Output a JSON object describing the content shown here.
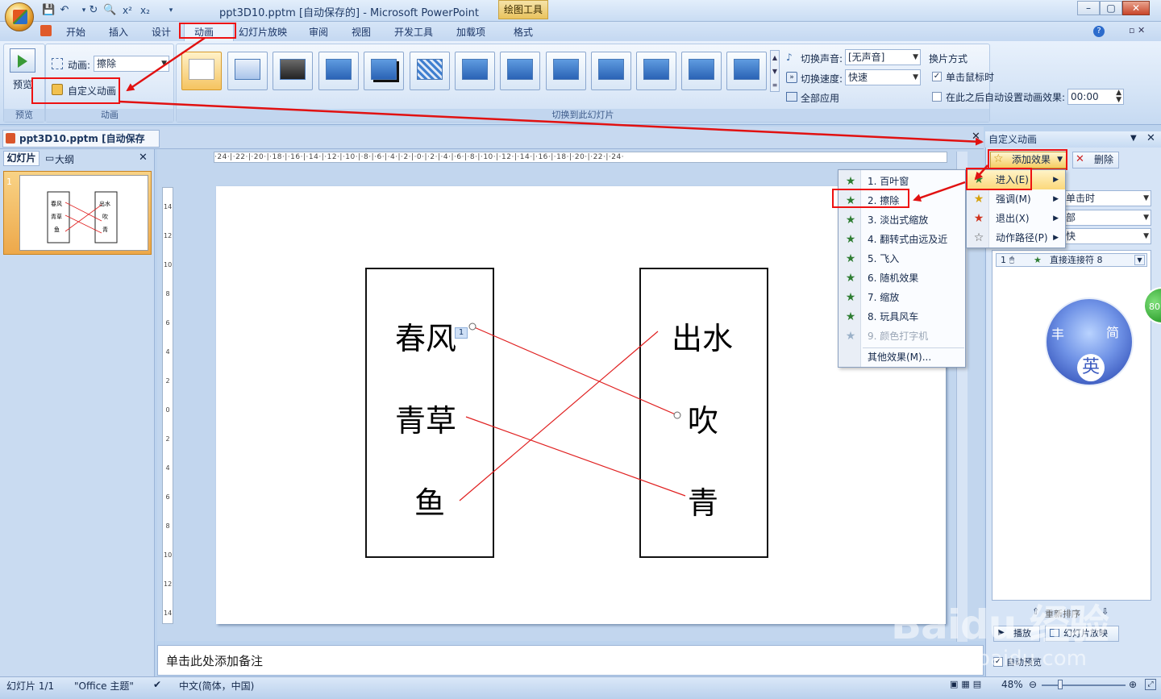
{
  "window": {
    "title": "ppt3D10.pptm [自动保存的] - Microsoft PowerPoint",
    "contextual_tools": "绘图工具",
    "controls": [
      "–",
      "▢",
      "✕"
    ]
  },
  "qat": {
    "icons": [
      "save-icon",
      "undo-icon",
      "redo-icon",
      "print-preview-icon",
      "superscript-icon",
      "subscript-icon",
      "customize-qat-icon"
    ],
    "superscript": "x²",
    "subscript": "x₂"
  },
  "tabs": [
    "开始",
    "插入",
    "设计",
    "动画",
    "幻灯片放映",
    "审阅",
    "视图",
    "开发工具",
    "加载项",
    "格式"
  ],
  "active_tab": "动画",
  "ribbon": {
    "preview": {
      "label": "预览",
      "group": "预览"
    },
    "animation_group": {
      "anim_label": "动画:",
      "anim_value": "擦除",
      "custom_anim": "自定义动画",
      "group": "动画"
    },
    "transition_group": {
      "group": "切换到此幻灯片",
      "sound_label": "切换声音:",
      "sound_value": "[无声音]",
      "speed_label": "切换速度:",
      "speed_value": "快速",
      "apply_all": "全部应用"
    },
    "advance_group": {
      "title": "换片方式",
      "on_click": "单击鼠标时",
      "on_click_checked": true,
      "after_label": "在此之后自动设置动画效果:",
      "after_checked": false,
      "after_value": "00:00"
    }
  },
  "doc_tab": "ppt3D10.pptm [自动保存的]",
  "left_pane": {
    "tabs": [
      "幻灯片",
      "大纲"
    ],
    "slide_number": "1",
    "thumb_left": [
      "春风",
      "青草",
      "鱼"
    ],
    "thumb_right": [
      "出水",
      "吹",
      "青"
    ]
  },
  "ruler": {
    "horizontal": "·24·|·22·|·20·|·18·|·16·|·14·|·12·|·10·|·8·|·6·|·4·|·2·|·0·|·2·|·4·|·6·|·8·|·10·|·12·|·14·|·16·|·18·|·20·|·22·|·24·",
    "vertical": [
      "14",
      "12",
      "10",
      "8",
      "6",
      "4",
      "2",
      "0",
      "2",
      "4",
      "6",
      "8",
      "10",
      "12",
      "14"
    ]
  },
  "slide": {
    "left_words": [
      "春风",
      "青草",
      "鱼"
    ],
    "right_words": [
      "出水",
      "吹",
      "青"
    ],
    "anim_tag": "1"
  },
  "notes_placeholder": "单击此处添加备注",
  "task_pane": {
    "title": "自定义动画",
    "add_effect": "添加效果",
    "remove": "删除",
    "categories": [
      {
        "label": "进入(E)",
        "icon": "entrance-star-icon"
      },
      {
        "label": "强调(M)",
        "icon": "emphasis-star-icon"
      },
      {
        "label": "退出(X)",
        "icon": "exit-star-icon"
      },
      {
        "label": "动作路径(P)",
        "icon": "motion-path-star-icon"
      }
    ],
    "partial_fields": [
      "单击时",
      "部",
      "快"
    ],
    "list_item": {
      "index": "1",
      "name": "直接连接符 8"
    },
    "reorder": "重新排序",
    "play": "播放",
    "slideshow": "幻灯片放映",
    "autopreview": "自动预览"
  },
  "entrance_menu": {
    "items": [
      {
        "label": "1. 百叶窗",
        "disabled": false
      },
      {
        "label": "2. 擦除",
        "disabled": false
      },
      {
        "label": "3. 淡出式缩放",
        "disabled": false
      },
      {
        "label": "4. 翻转式由远及近",
        "disabled": false
      },
      {
        "label": "5. 飞入",
        "disabled": false
      },
      {
        "label": "6. 随机效果",
        "disabled": false
      },
      {
        "label": "7. 缩放",
        "disabled": false
      },
      {
        "label": "8. 玩具风车",
        "disabled": false
      },
      {
        "label": "9. 颜色打字机",
        "disabled": true
      }
    ],
    "more": "其他效果(M)..."
  },
  "status": {
    "slide": "幻灯片 1/1",
    "theme": "\"Office 主题\"",
    "language": "中文(简体，中国)",
    "zoom": "48%"
  },
  "logo": {
    "chars": [
      "丰",
      "简",
      "英"
    ],
    "badge": "80"
  },
  "watermark": {
    "brand": "Baidu 经验",
    "url": "jingyan.baidu.com"
  },
  "colors": {
    "annotation_red": "#e11111",
    "connector_red": "#e02020",
    "active_tab_bg": "#eaf2fc"
  }
}
